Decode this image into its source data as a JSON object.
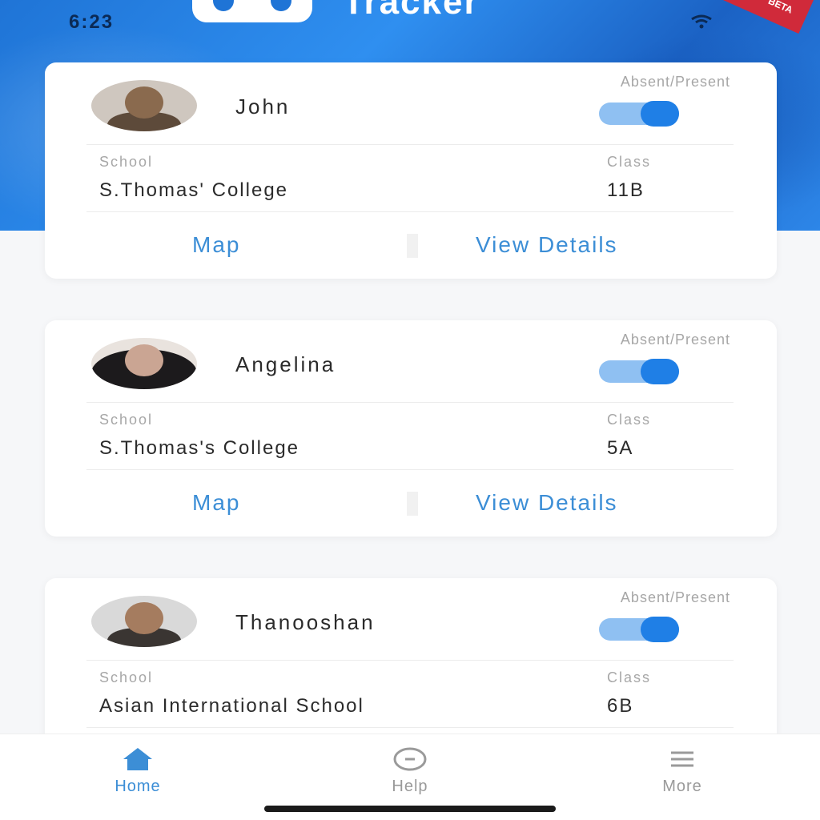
{
  "status_bar": {
    "time": "6:23",
    "badge": "BETA"
  },
  "app": {
    "title": "Tracker"
  },
  "cards": [
    {
      "name": "John",
      "ap_label": "Absent/Present",
      "present": true,
      "school_label": "School",
      "school": "S.Thomas' College",
      "class_label": "Class",
      "class": "11B",
      "map_label": "Map",
      "details_label": "View Details"
    },
    {
      "name": "Angelina",
      "ap_label": "Absent/Present",
      "present": true,
      "school_label": "School",
      "school": "S.Thomas's College",
      "class_label": "Class",
      "class": "5A",
      "map_label": "Map",
      "details_label": "View Details"
    },
    {
      "name": "Thanooshan",
      "ap_label": "Absent/Present",
      "present": true,
      "school_label": "School",
      "school": "Asian International School",
      "class_label": "Class",
      "class": "6B"
    }
  ],
  "bottom_nav": {
    "items": [
      {
        "label": "Home",
        "icon": "home-icon",
        "active": true
      },
      {
        "label": "Help",
        "icon": "help-icon",
        "active": false
      },
      {
        "label": "More",
        "icon": "menu-icon",
        "active": false
      }
    ]
  },
  "colors": {
    "brand_blue": "#1f74d6",
    "toggle_on": "#1f7fe6",
    "link": "#3c8ed6",
    "nav_active": "#3c8ed6",
    "nav_inactive": "#9a9a9a"
  }
}
